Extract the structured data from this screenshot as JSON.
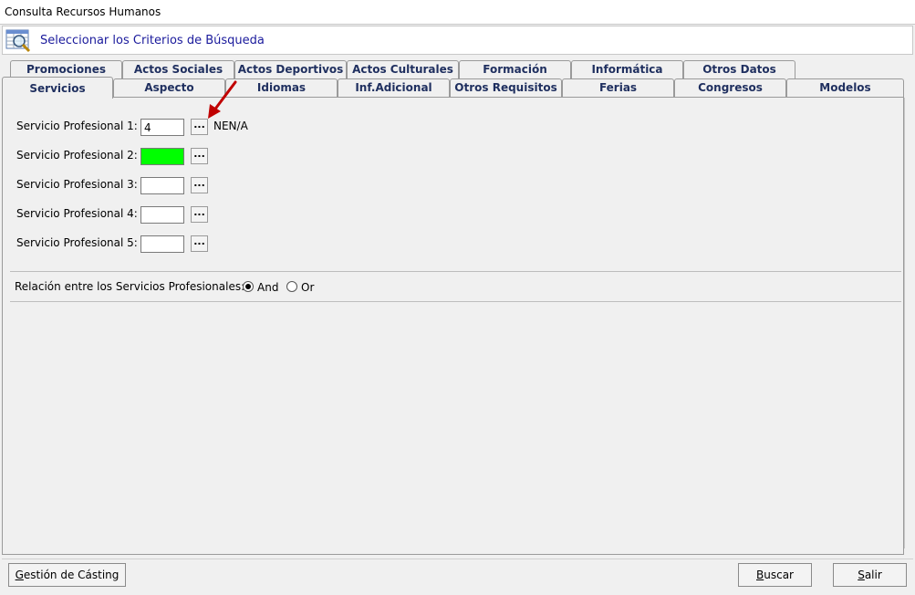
{
  "window": {
    "title": "Consulta Recursos Humanos"
  },
  "header": {
    "title": "Seleccionar los Criterios de Búsqueda",
    "icon": "search-grid-icon"
  },
  "tabs_row1": [
    "Promociones",
    "Actos Sociales",
    "Actos Deportivos",
    "Actos Culturales",
    "Formación",
    "Informática",
    "Otros Datos"
  ],
  "tabs_row2": [
    "Servicios",
    "Aspecto",
    "Idiomas",
    "Inf.Adicional",
    "Otros Requisitos",
    "Ferias",
    "Congresos",
    "Modelos"
  ],
  "active_tab": "Servicios",
  "services": [
    {
      "label": "Servicio Profesional 1:",
      "value": "4",
      "button": "...",
      "description": "NEN/A",
      "highlight": false
    },
    {
      "label": "Servicio Profesional 2:",
      "value": "",
      "button": "...",
      "description": "",
      "highlight": true
    },
    {
      "label": "Servicio Profesional 3:",
      "value": "",
      "button": "...",
      "description": "",
      "highlight": false
    },
    {
      "label": "Servicio Profesional 4:",
      "value": "",
      "button": "...",
      "description": "",
      "highlight": false
    },
    {
      "label": "Servicio Profesional 5:",
      "value": "",
      "button": "...",
      "description": "",
      "highlight": false
    }
  ],
  "relation": {
    "label": "Relación entre los Servicios Profesionales:",
    "options": [
      {
        "label": "And",
        "selected": true
      },
      {
        "label": "Or",
        "selected": false
      }
    ]
  },
  "buttons": {
    "casting_prefix": "G",
    "casting_rest": "estión de Cásting",
    "buscar_prefix": "B",
    "buscar_rest": "uscar",
    "salir_prefix": "S",
    "salir_rest": "alir"
  },
  "colors": {
    "highlight_field": "#00ff00",
    "header_text": "#1a1a9c",
    "tab_text": "#1f2f5f",
    "arrow": "#c00000"
  }
}
